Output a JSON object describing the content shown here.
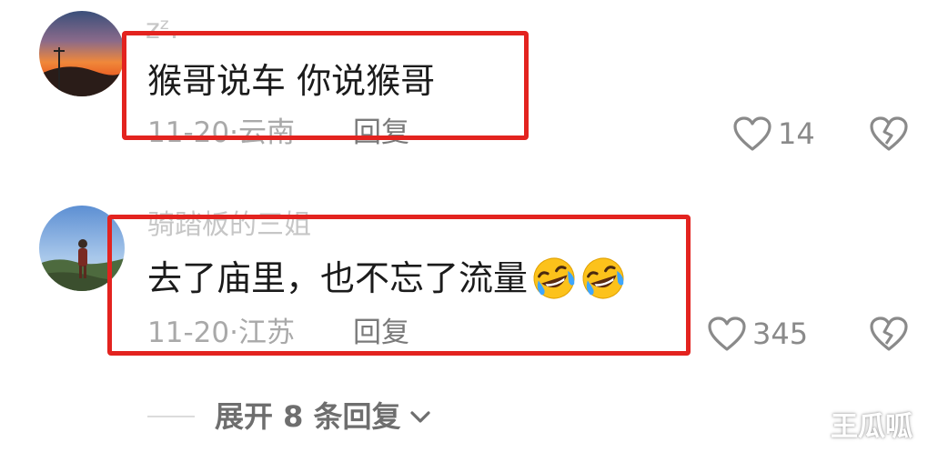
{
  "comments": [
    {
      "username": "zᶻ.",
      "text": "猴哥说车 你说猴哥",
      "date": "11-20",
      "separator": "·",
      "location": "云南",
      "reply_label": "回复",
      "likes": "14"
    },
    {
      "username": "骑踏板的三姐",
      "text": "去了庙里，也不忘了流量",
      "date": "11-20",
      "separator": "·",
      "location": "江苏",
      "reply_label": "回复",
      "likes": "345",
      "emojis": [
        "rofl-emoji",
        "rofl-emoji"
      ]
    }
  ],
  "expand_replies": {
    "label": "展开 8 条回复"
  },
  "watermark": "王瓜呱",
  "colors": {
    "highlight": "#e3231f",
    "text": "#1b1b1b",
    "meta": "#a9a9a9"
  }
}
